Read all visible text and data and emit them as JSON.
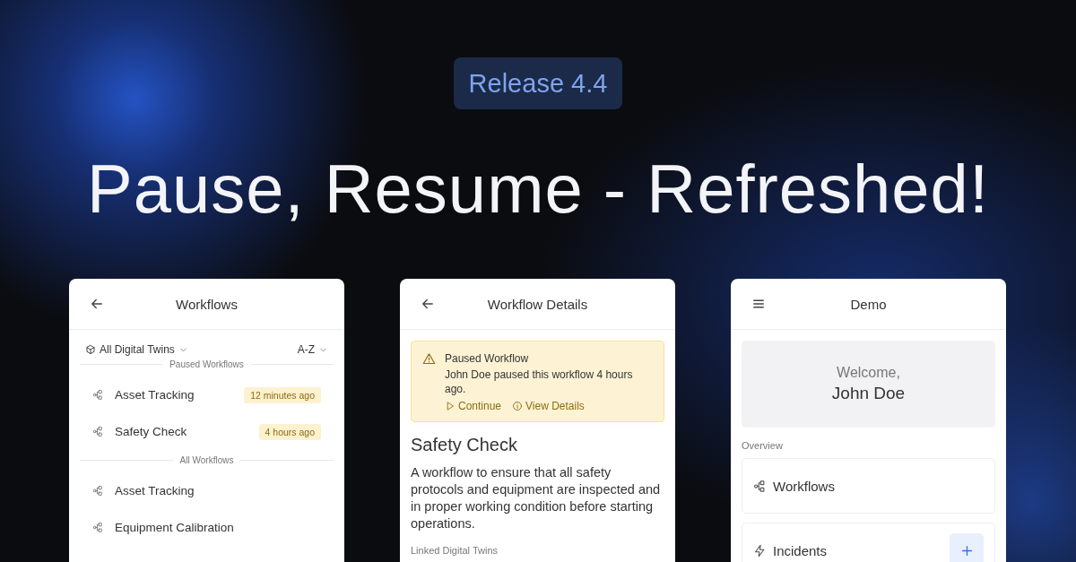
{
  "badge": "Release 4.4",
  "headline": "Pause, Resume - Refreshed!",
  "screens": [
    {
      "kind": "list",
      "title": "Workflows",
      "filter": "All Digital Twins",
      "sort": "A-Z",
      "sections": [
        {
          "heading": "Paused Workflows",
          "items": [
            {
              "name": "Asset Tracking",
              "badge": "12 minutes ago"
            },
            {
              "name": "Safety Check",
              "badge": "4 hours ago"
            }
          ]
        },
        {
          "heading": "All Workflows",
          "items": [
            {
              "name": "Asset Tracking"
            },
            {
              "name": "Equipment Calibration"
            }
          ]
        }
      ]
    },
    {
      "kind": "details",
      "title": "Workflow Details",
      "alert": {
        "title": "Paused Workflow",
        "message": "John Doe paused this workflow 4 hours ago.",
        "actions": [
          "Continue",
          "View Details"
        ]
      },
      "heading": "Safety Check",
      "description": "A workflow to ensure that all safety protocols and equipment are inspected and in proper working condition before starting operations.",
      "section_label": "Linked Digital Twins"
    },
    {
      "kind": "home",
      "title": "Demo",
      "welcome": "Welcome,",
      "user": "John Doe",
      "section_label": "Overview",
      "tiles": [
        {
          "label": "Workflows",
          "add": false
        },
        {
          "label": "Incidents",
          "add": true
        }
      ]
    }
  ]
}
